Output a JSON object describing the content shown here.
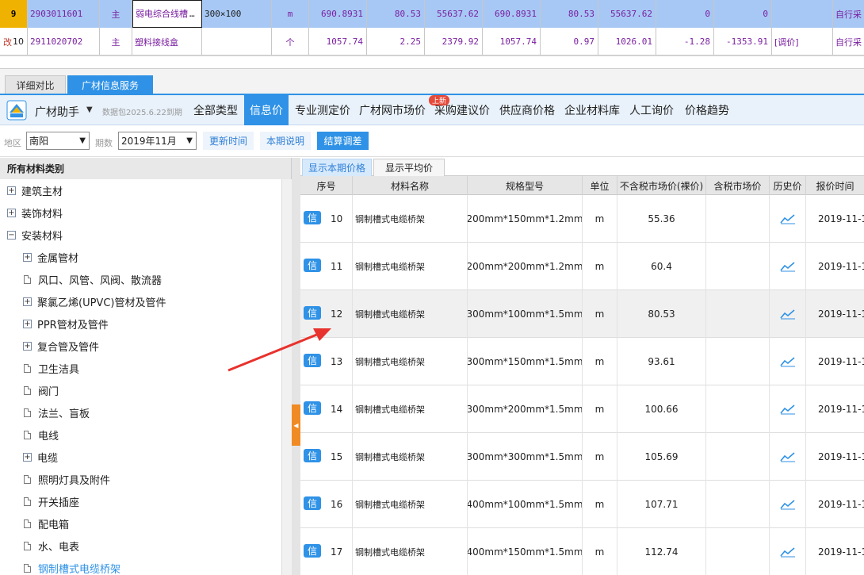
{
  "budget_grid": {
    "rows": [
      {
        "no": "9",
        "flag": "",
        "code": "2903011601",
        "type": "主",
        "name": "弱电综合线槽",
        "spec": "300×100",
        "unit": "m",
        "v1": "690.8931",
        "v2": "80.53",
        "v3": "55637.62",
        "v4": "690.8931",
        "v5": "80.53",
        "v6": "55637.62",
        "v7": "0",
        "v8": "0",
        "v9": "",
        "source": "自行采"
      },
      {
        "no": "10",
        "flag": "改",
        "code": "2911020702",
        "type": "主",
        "name": "塑料接线盒",
        "spec": "",
        "unit": "个",
        "v1": "1057.74",
        "v2": "2.25",
        "v3": "2379.92",
        "v4": "1057.74",
        "v5": "0.97",
        "v6": "1026.01",
        "v7": "-1.28",
        "v8": "-1353.91",
        "v9": "[调价]",
        "source": "自行采"
      }
    ],
    "ellipsis": "…"
  },
  "tabs": {
    "detail_compare": "详细对比",
    "info_service": "广材信息服务"
  },
  "toolbar": {
    "brand": "广材助手",
    "caret": "▼",
    "package_note": "数据包2025.6.22到期",
    "nav": [
      "全部类型",
      "信息价",
      "专业测定价",
      "广材网市场价",
      "采购建议价",
      "供应商价格",
      "企业材料库",
      "人工询价",
      "价格趋势"
    ],
    "new_badge": "上新"
  },
  "filters": {
    "region_label": "地区",
    "region_value": "南阳",
    "period_label": "期数",
    "period_value": "2019年11月",
    "update_time": "更新时间",
    "period_note": "本期说明",
    "settle": "结算调差"
  },
  "tree": {
    "header": "所有材料类别",
    "items": [
      {
        "label": "建筑主材",
        "kind": "plus",
        "level": 0
      },
      {
        "label": "装饰材料",
        "kind": "plus",
        "level": 0
      },
      {
        "label": "安装材料",
        "kind": "minus",
        "level": 0
      },
      {
        "label": "金属管材",
        "kind": "plus",
        "level": 1
      },
      {
        "label": "风口、风管、风阀、散流器",
        "kind": "doc",
        "level": 1
      },
      {
        "label": "聚氯乙烯(UPVC)管材及管件",
        "kind": "plus",
        "level": 1
      },
      {
        "label": "PPR管材及管件",
        "kind": "plus",
        "level": 1
      },
      {
        "label": "复合管及管件",
        "kind": "plus",
        "level": 1
      },
      {
        "label": "卫生洁具",
        "kind": "doc",
        "level": 1
      },
      {
        "label": "阀门",
        "kind": "doc",
        "level": 1
      },
      {
        "label": "法兰、盲板",
        "kind": "doc",
        "level": 1
      },
      {
        "label": "电线",
        "kind": "doc",
        "level": 1
      },
      {
        "label": "电缆",
        "kind": "plus",
        "level": 1
      },
      {
        "label": "照明灯具及附件",
        "kind": "doc",
        "level": 1
      },
      {
        "label": "开关插座",
        "kind": "doc",
        "level": 1
      },
      {
        "label": "配电箱",
        "kind": "doc",
        "level": 1
      },
      {
        "label": "水、电表",
        "kind": "doc",
        "level": 1
      },
      {
        "label": "钢制槽式电缆桥架",
        "kind": "doc",
        "level": 1,
        "selected": true
      }
    ]
  },
  "price_table": {
    "subtab_active": "显示本期价格",
    "subtab_other": "显示平均价",
    "headers": [
      "序号",
      "材料名称",
      "规格型号",
      "单位",
      "不含税市场价(裸价)",
      "含税市场价",
      "历史价",
      "报价时间"
    ],
    "badge": "信",
    "rows": [
      {
        "seq": "10",
        "name": "钢制槽式电缆桥架",
        "spec": "200mm*150mm*1.2mm",
        "unit": "m",
        "price": "55.36",
        "tax_price": "",
        "date": "2019-11-1"
      },
      {
        "seq": "11",
        "name": "钢制槽式电缆桥架",
        "spec": "200mm*200mm*1.2mm",
        "unit": "m",
        "price": "60.4",
        "tax_price": "",
        "date": "2019-11-1"
      },
      {
        "seq": "12",
        "name": "钢制槽式电缆桥架",
        "spec": "300mm*100mm*1.5mm",
        "unit": "m",
        "price": "80.53",
        "tax_price": "",
        "date": "2019-11-1",
        "highlight": true
      },
      {
        "seq": "13",
        "name": "钢制槽式电缆桥架",
        "spec": "300mm*150mm*1.5mm",
        "unit": "m",
        "price": "93.61",
        "tax_price": "",
        "date": "2019-11-1"
      },
      {
        "seq": "14",
        "name": "钢制槽式电缆桥架",
        "spec": "300mm*200mm*1.5mm",
        "unit": "m",
        "price": "100.66",
        "tax_price": "",
        "date": "2019-11-1"
      },
      {
        "seq": "15",
        "name": "钢制槽式电缆桥架",
        "spec": "300mm*300mm*1.5mm",
        "unit": "m",
        "price": "105.69",
        "tax_price": "",
        "date": "2019-11-1"
      },
      {
        "seq": "16",
        "name": "钢制槽式电缆桥架",
        "spec": "400mm*100mm*1.5mm",
        "unit": "m",
        "price": "107.71",
        "tax_price": "",
        "date": "2019-11-1"
      },
      {
        "seq": "17",
        "name": "钢制槽式电缆桥架",
        "spec": "400mm*150mm*1.5mm",
        "unit": "m",
        "price": "112.74",
        "tax_price": "",
        "date": "2019-11-1"
      }
    ]
  },
  "colors": {
    "accent": "#2f92e6",
    "arrow": "#e8322d",
    "handle": "#f08a24",
    "row_select": "#a7c8f5"
  },
  "icons": {
    "history": "trend-chart-icon",
    "logo": "guangcai-logo-icon",
    "collapse": "triangle-left-icon"
  }
}
